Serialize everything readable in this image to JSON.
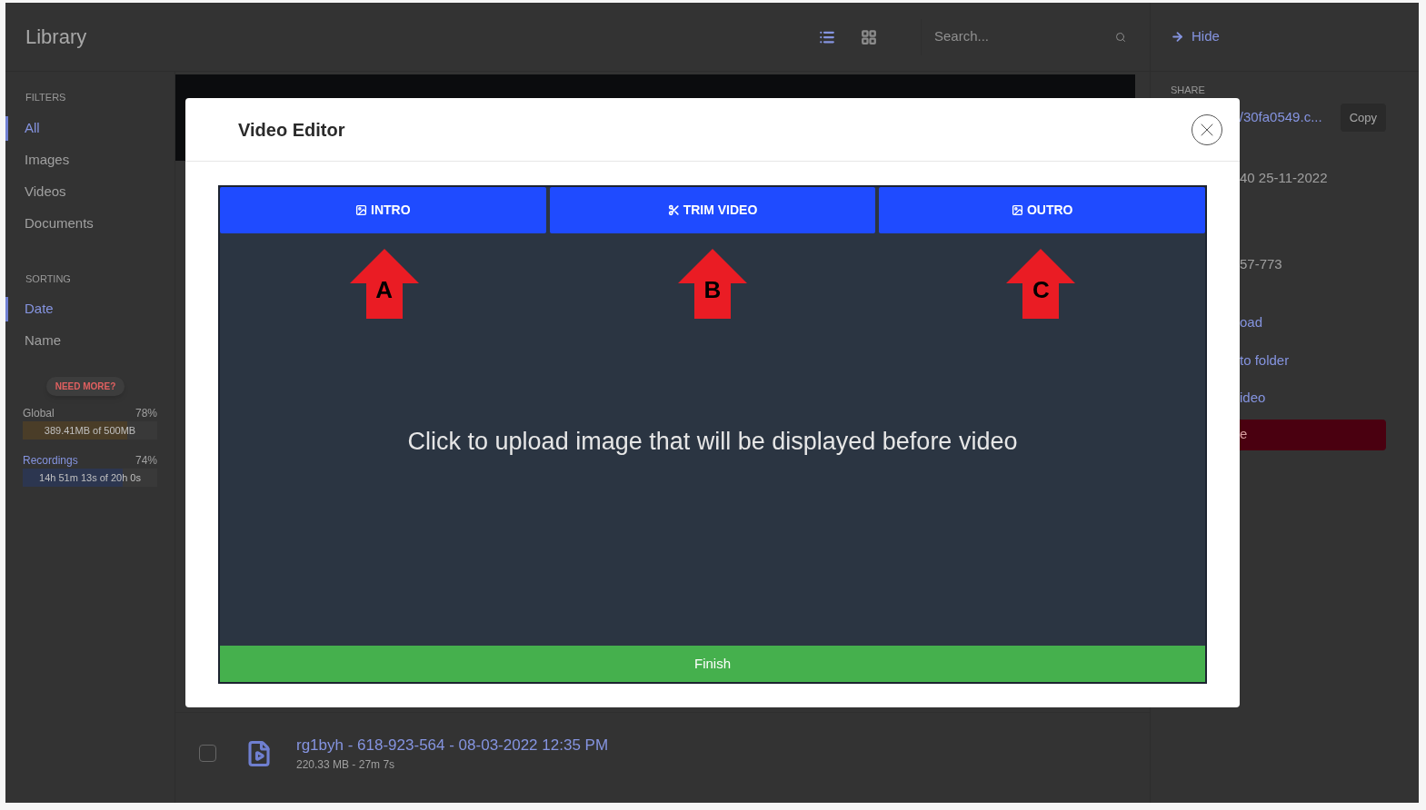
{
  "sidebar": {
    "title": "Library",
    "filters_heading": "FILTERS",
    "filters": [
      {
        "label": "All",
        "selected": true
      },
      {
        "label": "Images",
        "selected": false
      },
      {
        "label": "Videos",
        "selected": false
      },
      {
        "label": "Documents",
        "selected": false
      }
    ],
    "sorting_heading": "SORTING",
    "sorting": [
      {
        "label": "Date",
        "selected": true
      },
      {
        "label": "Name",
        "selected": false
      }
    ],
    "upgrade_button": "NEED MORE?",
    "usage": [
      {
        "kind": "global",
        "label": "Global",
        "percent": "78%",
        "detail": "389.41MB of 500MB",
        "level": 0.78
      },
      {
        "kind": "recordings",
        "label": "Recordings",
        "percent": "74%",
        "detail": "14h 51m 13s of 20h 0s",
        "level": 0.74
      }
    ]
  },
  "toolbar": {
    "views": [
      {
        "kind": "list",
        "selected": true
      },
      {
        "kind": "grid",
        "selected": false
      }
    ],
    "search": {
      "placeholder": "Search..."
    }
  },
  "files": [
    {
      "name": "rg1byh - 618-923-564 - 08-03-2022 12:35 PM",
      "meta": "220.33 MB - 27m 7s",
      "checked": false
    }
  ],
  "details": {
    "hide": "Hide",
    "share_heading": "SHARE",
    "share_link": "/30fa0549.c...",
    "copy": "Copy",
    "date": "40 25-11-2022",
    "code": "57-773",
    "actions": [
      "oad",
      "to folder",
      "ideo"
    ],
    "danger_button": "e"
  },
  "modal": {
    "title": "Video Editor",
    "tabs": [
      {
        "label": "INTRO",
        "kind": "image"
      },
      {
        "label": "TRIM VIDEO",
        "kind": "trim"
      },
      {
        "label": "OUTRO",
        "kind": "image"
      }
    ],
    "annotations": [
      "A",
      "B",
      "C"
    ],
    "message": "Click to upload image that will be displayed before video",
    "finish": "Finish"
  }
}
